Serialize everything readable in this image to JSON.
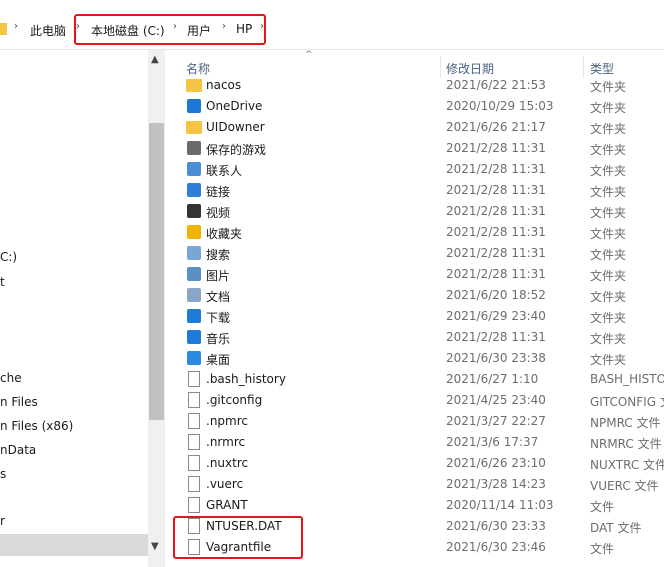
{
  "address": {
    "crumbs": [
      "此电脑",
      "本地磁盘 (C:)",
      "用户",
      "HP"
    ]
  },
  "nav": {
    "items": [
      "C:)",
      "t",
      "che",
      "n Files",
      "n Files (x86)",
      "nData",
      "s",
      "r"
    ]
  },
  "columns": {
    "name": "名称",
    "date": "修改日期",
    "type": "类型"
  },
  "files": [
    {
      "name": "nacos",
      "date": "2021/6/22 21:53",
      "type": "文件夹",
      "icon": "folder-icon"
    },
    {
      "name": "OneDrive",
      "date": "2020/10/29 15:03",
      "type": "文件夹",
      "icon": "cloud-icon"
    },
    {
      "name": "UIDowner",
      "date": "2021/6/26 21:17",
      "type": "文件夹",
      "icon": "folder-icon"
    },
    {
      "name": "保存的游戏",
      "date": "2021/2/28 11:31",
      "type": "文件夹",
      "icon": "game-piece-icon"
    },
    {
      "name": "联系人",
      "date": "2021/2/28 11:31",
      "type": "文件夹",
      "icon": "contacts-icon"
    },
    {
      "name": "链接",
      "date": "2021/2/28 11:31",
      "type": "文件夹",
      "icon": "link-arrow-icon"
    },
    {
      "name": "视频",
      "date": "2021/2/28 11:31",
      "type": "文件夹",
      "icon": "film-icon"
    },
    {
      "name": "收藏夹",
      "date": "2021/2/28 11:31",
      "type": "文件夹",
      "icon": "star-icon"
    },
    {
      "name": "搜索",
      "date": "2021/2/28 11:31",
      "type": "文件夹",
      "icon": "search-icon"
    },
    {
      "name": "图片",
      "date": "2021/2/28 11:31",
      "type": "文件夹",
      "icon": "picture-icon"
    },
    {
      "name": "文档",
      "date": "2021/6/20 18:52",
      "type": "文件夹",
      "icon": "document-icon"
    },
    {
      "name": "下载",
      "date": "2021/6/29 23:40",
      "type": "文件夹",
      "icon": "download-icon"
    },
    {
      "name": "音乐",
      "date": "2021/2/28 11:31",
      "type": "文件夹",
      "icon": "music-icon"
    },
    {
      "name": "桌面",
      "date": "2021/6/30 23:38",
      "type": "文件夹",
      "icon": "desktop-icon"
    },
    {
      "name": ".bash_history",
      "date": "2021/6/27 1:10",
      "type": "BASH_HISTO",
      "icon": "file-icon"
    },
    {
      "name": ".gitconfig",
      "date": "2021/4/25 23:40",
      "type": "GITCONFIG 文",
      "icon": "file-icon"
    },
    {
      "name": ".npmrc",
      "date": "2021/3/27 22:27",
      "type": "NPMRC 文件",
      "icon": "file-icon"
    },
    {
      "name": ".nrmrc",
      "date": "2021/3/6 17:37",
      "type": "NRMRC 文件",
      "icon": "file-icon"
    },
    {
      "name": ".nuxtrc",
      "date": "2021/6/26 23:10",
      "type": "NUXTRC 文件",
      "icon": "file-icon"
    },
    {
      "name": ".vuerc",
      "date": "2021/3/28 14:23",
      "type": "VUERC 文件",
      "icon": "file-icon"
    },
    {
      "name": "GRANT",
      "date": "2020/11/14 11:03",
      "type": "文件",
      "icon": "file-icon"
    },
    {
      "name": "NTUSER.DAT",
      "date": "2021/6/30 23:33",
      "type": "DAT 文件",
      "icon": "file-icon"
    },
    {
      "name": "Vagrantfile",
      "date": "2021/6/30 23:46",
      "type": "文件",
      "icon": "file-icon"
    }
  ]
}
